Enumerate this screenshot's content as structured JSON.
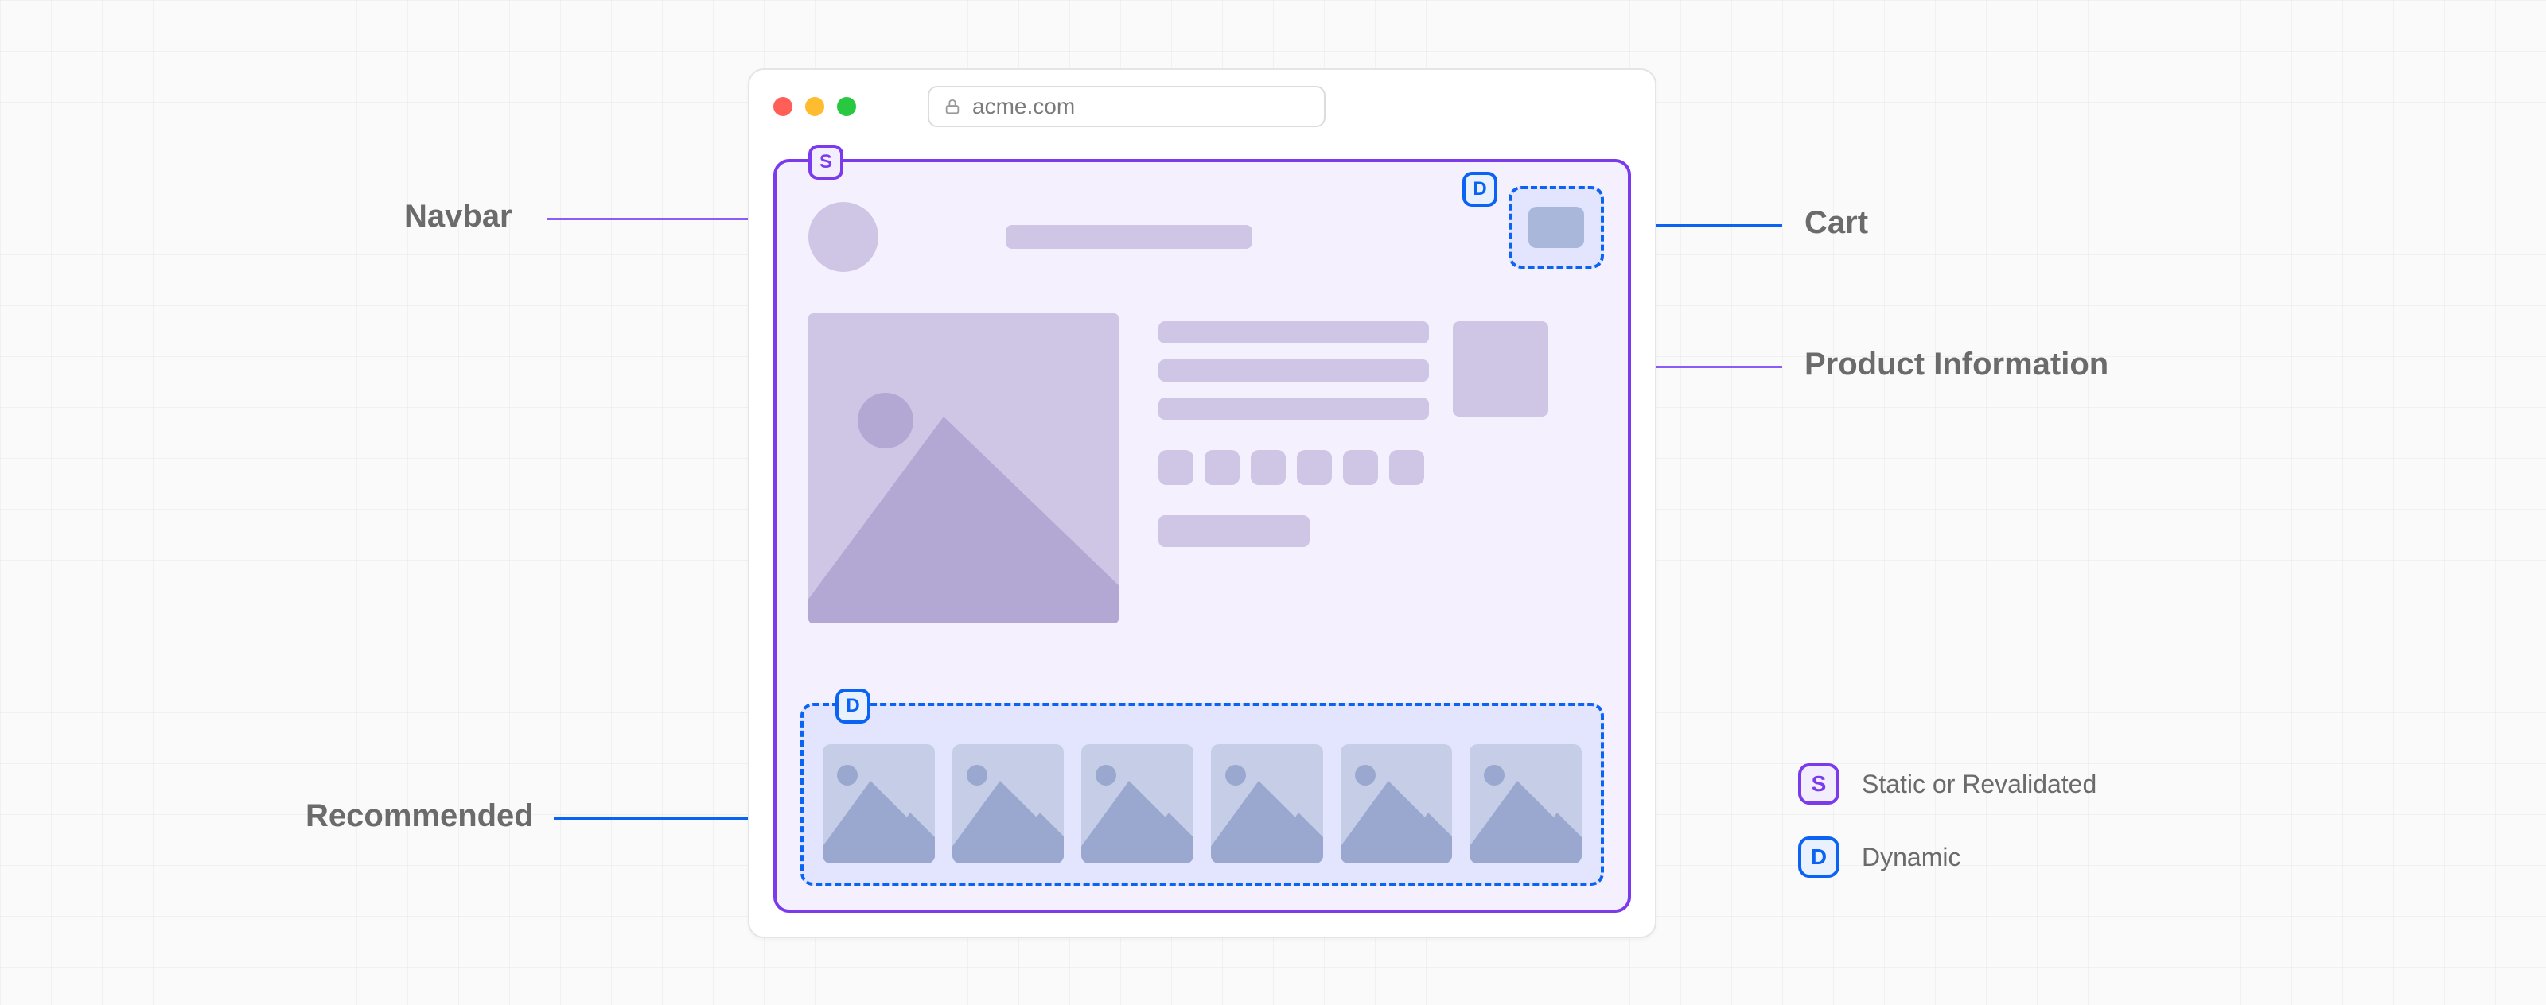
{
  "browser": {
    "url": "acme.com"
  },
  "labels": {
    "navbar": "Navbar",
    "cart": "Cart",
    "product_info": "Product Information",
    "recommended": "Recommended"
  },
  "tags": {
    "static_letter": "S",
    "dynamic_letter": "D"
  },
  "legend": {
    "static": {
      "letter": "S",
      "text": "Static or Revalidated"
    },
    "dynamic": {
      "letter": "D",
      "text": "Dynamic"
    }
  },
  "recommended_count": 6
}
